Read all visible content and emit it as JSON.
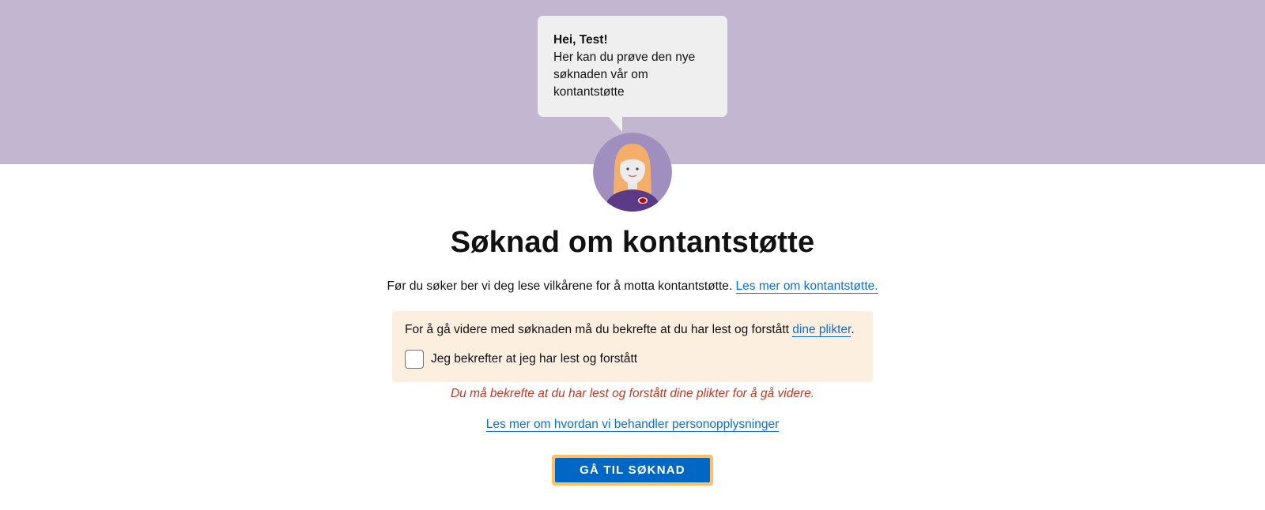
{
  "bubble": {
    "greeting": "Hei, Test!",
    "message": "Her kan du prøve den nye søknaden vår om kontantstøtte"
  },
  "avatar": {
    "icon": "veileder-avatar-icon"
  },
  "title": "Søknad om kontantstøtte",
  "intro": {
    "text": "Før du søker ber vi deg lese vilkårene for å motta kontantstøtte.",
    "link": "Les mer om kontantstøtte."
  },
  "confirm": {
    "text_before": "For å gå videre med søknaden må du bekrefte at du har lest og forstått",
    "link": "dine plikter",
    "text_after": ".",
    "checkbox_label": "Jeg bekrefter at jeg har lest og forstått",
    "checked": false
  },
  "error": "Du må bekrefte at du har lest og forstått dine plikter for å gå videre.",
  "privacy_link": "Les mer om hvordan vi behandler personopplysninger",
  "cta_label": "GÅ TIL SØKNAD",
  "colors": {
    "banner": "#c3b6d0",
    "bubble": "#efefef",
    "link": "#0a6fd1",
    "confirm_bg": "#fdefe0",
    "error": "#ba3a26",
    "button": "#0067c5",
    "focus_outline": "#ffbd66"
  }
}
